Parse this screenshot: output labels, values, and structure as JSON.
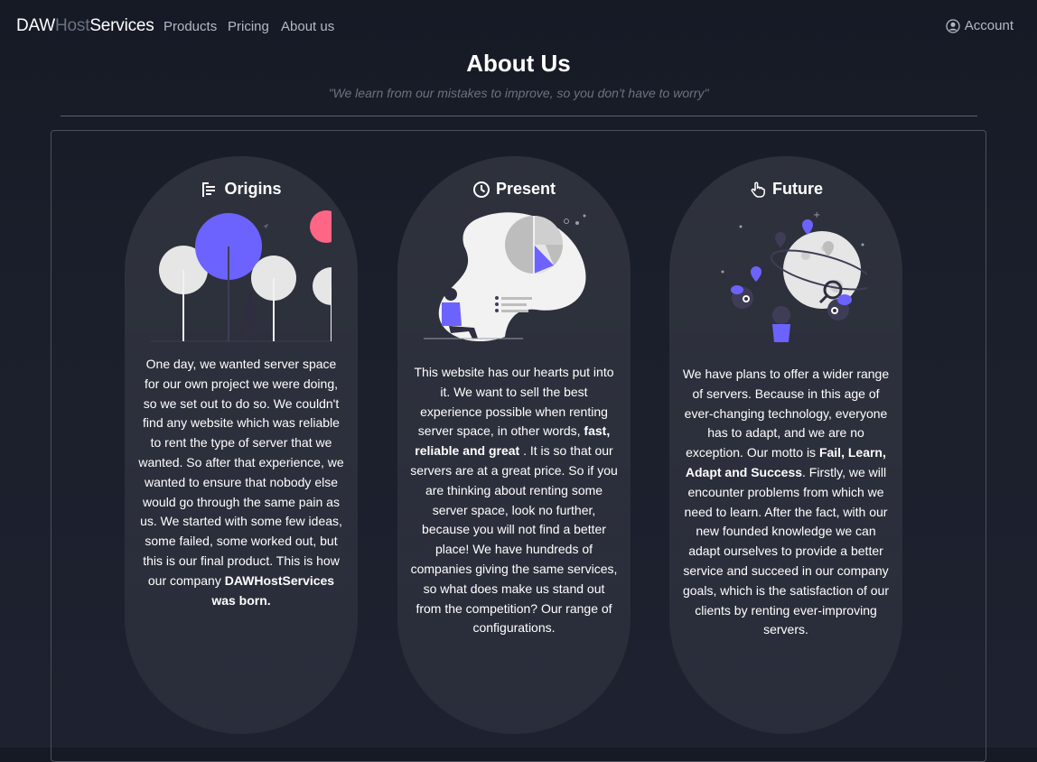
{
  "nav": {
    "brand": {
      "part1": "DAW",
      "part2": "Host",
      "part3": "Services"
    },
    "links": [
      "Products",
      "Pricing",
      "About us"
    ],
    "account_label": "Account"
  },
  "page": {
    "title": "About Us",
    "quote": "\"We learn from our mistakes to improve, so you don't have to worry\""
  },
  "cards": [
    {
      "icon": "list-tree-icon",
      "title": "Origins",
      "text_a": "One day, we wanted server space for our own project we were doing, so we set out to do so. We couldn't find any website which was reliable to rent the type of server that we wanted. So after that experience, we wanted to ensure that nobody else would go through the same pain as us. We started with some few ideas, some failed, some worked out, but this is our final product. This is how our company ",
      "bold_a": "DAWHostServices was born.",
      "text_b": "",
      "bold_b": "",
      "text_c": ""
    },
    {
      "icon": "clock-icon",
      "title": "Present",
      "text_a": "This website has our hearts put into it. We want to sell the best experience possible when renting server space, in other words, ",
      "bold_a": "fast, reliable and great",
      "text_b": " . It is so that our servers are at a great price. So if you are thinking about renting some server space, look no further, because you will not find a better place! We have hundreds of companies giving the same services, so what does make us stand out from the competition? Our range of configurations.",
      "bold_b": "",
      "text_c": ""
    },
    {
      "icon": "pointer-hand-icon",
      "title": "Future",
      "text_a": "We have plans to offer a wider range of servers. Because in this age of ever-changing technology, everyone has to adapt, and we are no exception. Our motto is ",
      "bold_a": "Fail, Learn, Adapt and Success",
      "text_b": ". Firstly, we will encounter problems from which we need to learn. After the fact, with our new founded knowledge we can adapt ourselves to provide a better service and succeed in our company goals, which is the satisfaction of our clients by renting ever-improving servers.",
      "bold_b": "",
      "text_c": ""
    }
  ],
  "colors": {
    "accent": "#6c63ff",
    "pink": "#ff6584",
    "background": "#1b1f2b"
  }
}
